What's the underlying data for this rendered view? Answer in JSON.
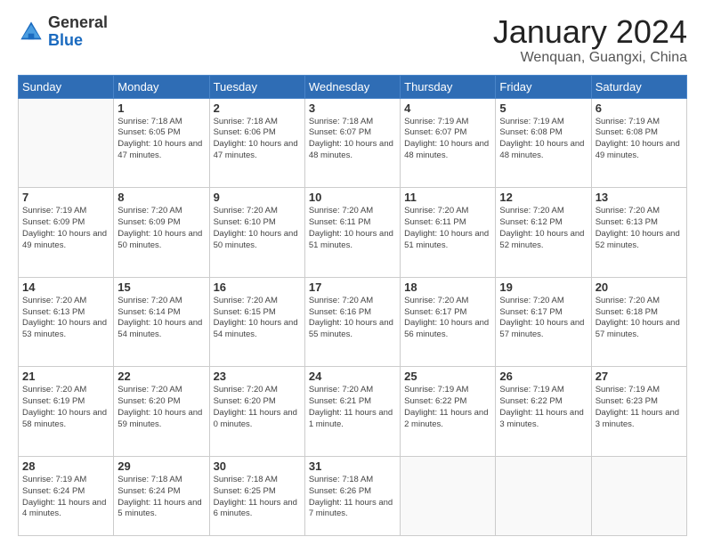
{
  "header": {
    "logo_general": "General",
    "logo_blue": "Blue",
    "title": "January 2024",
    "location": "Wenquan, Guangxi, China"
  },
  "weekdays": [
    "Sunday",
    "Monday",
    "Tuesday",
    "Wednesday",
    "Thursday",
    "Friday",
    "Saturday"
  ],
  "weeks": [
    [
      {
        "day": "",
        "info": ""
      },
      {
        "day": "1",
        "info": "Sunrise: 7:18 AM\nSunset: 6:05 PM\nDaylight: 10 hours\nand 47 minutes."
      },
      {
        "day": "2",
        "info": "Sunrise: 7:18 AM\nSunset: 6:06 PM\nDaylight: 10 hours\nand 47 minutes."
      },
      {
        "day": "3",
        "info": "Sunrise: 7:18 AM\nSunset: 6:07 PM\nDaylight: 10 hours\nand 48 minutes."
      },
      {
        "day": "4",
        "info": "Sunrise: 7:19 AM\nSunset: 6:07 PM\nDaylight: 10 hours\nand 48 minutes."
      },
      {
        "day": "5",
        "info": "Sunrise: 7:19 AM\nSunset: 6:08 PM\nDaylight: 10 hours\nand 48 minutes."
      },
      {
        "day": "6",
        "info": "Sunrise: 7:19 AM\nSunset: 6:08 PM\nDaylight: 10 hours\nand 49 minutes."
      }
    ],
    [
      {
        "day": "7",
        "info": ""
      },
      {
        "day": "8",
        "info": "Sunrise: 7:20 AM\nSunset: 6:09 PM\nDaylight: 10 hours\nand 50 minutes."
      },
      {
        "day": "9",
        "info": "Sunrise: 7:20 AM\nSunset: 6:10 PM\nDaylight: 10 hours\nand 50 minutes."
      },
      {
        "day": "10",
        "info": "Sunrise: 7:20 AM\nSunset: 6:11 PM\nDaylight: 10 hours\nand 51 minutes."
      },
      {
        "day": "11",
        "info": "Sunrise: 7:20 AM\nSunset: 6:11 PM\nDaylight: 10 hours\nand 51 minutes."
      },
      {
        "day": "12",
        "info": "Sunrise: 7:20 AM\nSunset: 6:12 PM\nDaylight: 10 hours\nand 52 minutes."
      },
      {
        "day": "13",
        "info": "Sunrise: 7:20 AM\nSunset: 6:13 PM\nDaylight: 10 hours\nand 52 minutes."
      }
    ],
    [
      {
        "day": "14",
        "info": ""
      },
      {
        "day": "15",
        "info": "Sunrise: 7:20 AM\nSunset: 6:14 PM\nDaylight: 10 hours\nand 54 minutes."
      },
      {
        "day": "16",
        "info": "Sunrise: 7:20 AM\nSunset: 6:15 PM\nDaylight: 10 hours\nand 54 minutes."
      },
      {
        "day": "17",
        "info": "Sunrise: 7:20 AM\nSunset: 6:16 PM\nDaylight: 10 hours\nand 55 minutes."
      },
      {
        "day": "18",
        "info": "Sunrise: 7:20 AM\nSunset: 6:17 PM\nDaylight: 10 hours\nand 56 minutes."
      },
      {
        "day": "19",
        "info": "Sunrise: 7:20 AM\nSunset: 6:17 PM\nDaylight: 10 hours\nand 57 minutes."
      },
      {
        "day": "20",
        "info": "Sunrise: 7:20 AM\nSunset: 6:18 PM\nDaylight: 10 hours\nand 57 minutes."
      }
    ],
    [
      {
        "day": "21",
        "info": ""
      },
      {
        "day": "22",
        "info": "Sunrise: 7:20 AM\nSunset: 6:20 PM\nDaylight: 10 hours\nand 59 minutes."
      },
      {
        "day": "23",
        "info": "Sunrise: 7:20 AM\nSunset: 6:20 PM\nDaylight: 11 hours\nand 0 minutes."
      },
      {
        "day": "24",
        "info": "Sunrise: 7:20 AM\nSunset: 6:21 PM\nDaylight: 11 hours\nand 1 minute."
      },
      {
        "day": "25",
        "info": "Sunrise: 7:19 AM\nSunset: 6:22 PM\nDaylight: 11 hours\nand 2 minutes."
      },
      {
        "day": "26",
        "info": "Sunrise: 7:19 AM\nSunset: 6:22 PM\nDaylight: 11 hours\nand 3 minutes."
      },
      {
        "day": "27",
        "info": "Sunrise: 7:19 AM\nSunset: 6:23 PM\nDaylight: 11 hours\nand 3 minutes."
      }
    ],
    [
      {
        "day": "28",
        "info": "Sunrise: 7:19 AM\nSunset: 6:24 PM\nDaylight: 11 hours\nand 4 minutes."
      },
      {
        "day": "29",
        "info": "Sunrise: 7:18 AM\nSunset: 6:24 PM\nDaylight: 11 hours\nand 5 minutes."
      },
      {
        "day": "30",
        "info": "Sunrise: 7:18 AM\nSunset: 6:25 PM\nDaylight: 11 hours\nand 6 minutes."
      },
      {
        "day": "31",
        "info": "Sunrise: 7:18 AM\nSunset: 6:26 PM\nDaylight: 11 hours\nand 7 minutes."
      },
      {
        "day": "",
        "info": ""
      },
      {
        "day": "",
        "info": ""
      },
      {
        "day": "",
        "info": ""
      }
    ]
  ],
  "week1_sunday": {
    "day": "7",
    "info": "Sunrise: 7:19 AM\nSunset: 6:09 PM\nDaylight: 10 hours\nand 49 minutes."
  },
  "week2_sunday": {
    "day": "14",
    "info": "Sunrise: 7:20 AM\nSunset: 6:13 PM\nDaylight: 10 hours\nand 53 minutes."
  },
  "week3_sunday": {
    "day": "21",
    "info": "Sunrise: 7:20 AM\nSunset: 6:19 PM\nDaylight: 10 hours\nand 58 minutes."
  }
}
